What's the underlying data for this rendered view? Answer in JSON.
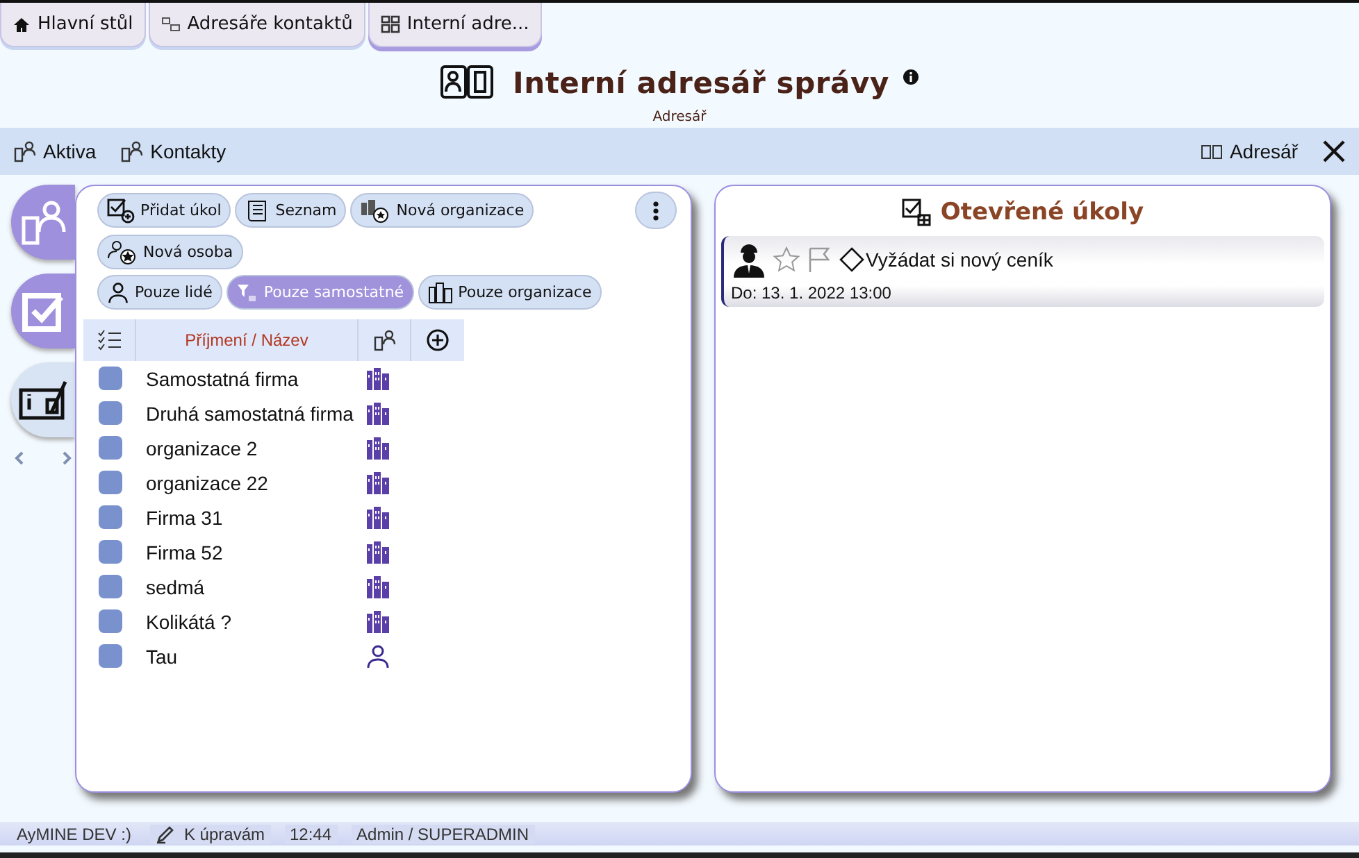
{
  "tabs": [
    {
      "label": "Hlavní stůl",
      "selected": false
    },
    {
      "label": "Adresáře kontaktů",
      "selected": false
    },
    {
      "label": "Interní adre...",
      "selected": true
    }
  ],
  "header": {
    "title": "Interní adresář správy",
    "subtitle": "Adresář"
  },
  "toolbar": {
    "left": [
      "Aktiva",
      "Kontakty"
    ],
    "right": "Adresář"
  },
  "side_nav": [
    {
      "selected": true
    },
    {
      "selected": true
    },
    {
      "selected": false
    }
  ],
  "actions": [
    "Přidat úkol",
    "Seznam",
    "Nová organizace",
    "Nová osoba"
  ],
  "filters": [
    {
      "label": "Pouze lidé",
      "selected": false
    },
    {
      "label": "Pouze samostatné",
      "selected": true
    },
    {
      "label": "Pouze organizace",
      "selected": false
    }
  ],
  "table": {
    "columns": [
      "Příjmení / Název"
    ],
    "rows": [
      {
        "name": "Samostatná firma",
        "kind": "organization"
      },
      {
        "name": "Druhá samostatná firma",
        "kind": "organization"
      },
      {
        "name": "organizace 2",
        "kind": "organization"
      },
      {
        "name": "organizace 22",
        "kind": "organization"
      },
      {
        "name": "Firma 31",
        "kind": "organization"
      },
      {
        "name": "Firma 52",
        "kind": "organization"
      },
      {
        "name": "sedmá",
        "kind": "organization"
      },
      {
        "name": "Kolikátá ?",
        "kind": "organization"
      },
      {
        "name": "Tau",
        "kind": "person"
      }
    ]
  },
  "tasks": {
    "title": "Otevřené úkoly",
    "items": [
      {
        "title": "Vyžádat si nový ceník",
        "due": "Do: 13. 1. 2022 13:00",
        "starred": false,
        "flagged": false
      }
    ]
  },
  "status_bar": [
    "AyMINE DEV :)",
    "K úpravám",
    "12:44",
    "Admin / SUPERADMIN"
  ]
}
